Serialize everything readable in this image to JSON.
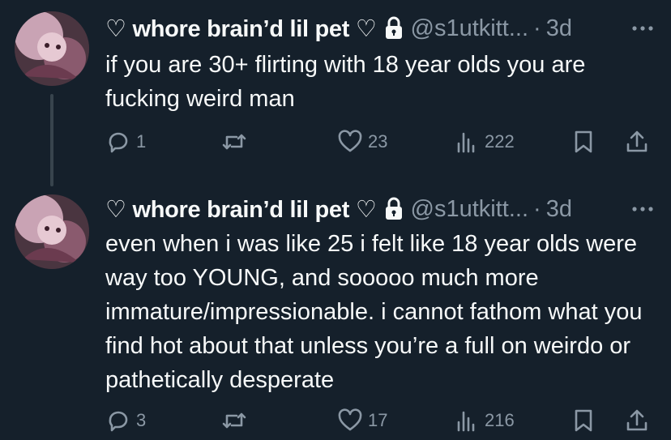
{
  "tweets": [
    {
      "display_name": "♡ whore brain’d lil pet ♡",
      "handle": "@s1utkitt...",
      "dot": "·",
      "time": "3d",
      "text": "if you are 30+ flirting with 18 year olds you are fucking weird man",
      "replies": "1",
      "retweets": "",
      "likes": "23",
      "views": "222"
    },
    {
      "display_name": "♡ whore brain’d lil pet ♡",
      "handle": "@s1utkitt...",
      "dot": "·",
      "time": "3d",
      "text": "even when i was like 25 i felt like 18 year olds were way too YOUNG, and sooooo much more immature/impressionable. i cannot fathom what you find hot about that unless you’re a full on weirdo or pathetically desperate",
      "replies": "3",
      "retweets": "",
      "likes": "17",
      "views": "216"
    }
  ],
  "colors": {
    "background": "#15202b",
    "text": "#f7f9f9",
    "muted": "#8b98a5",
    "thread_line": "#38444d"
  },
  "icons": [
    "lock-icon",
    "more-icon",
    "reply-icon",
    "retweet-icon",
    "like-icon",
    "views-icon",
    "bookmark-icon",
    "share-icon"
  ]
}
